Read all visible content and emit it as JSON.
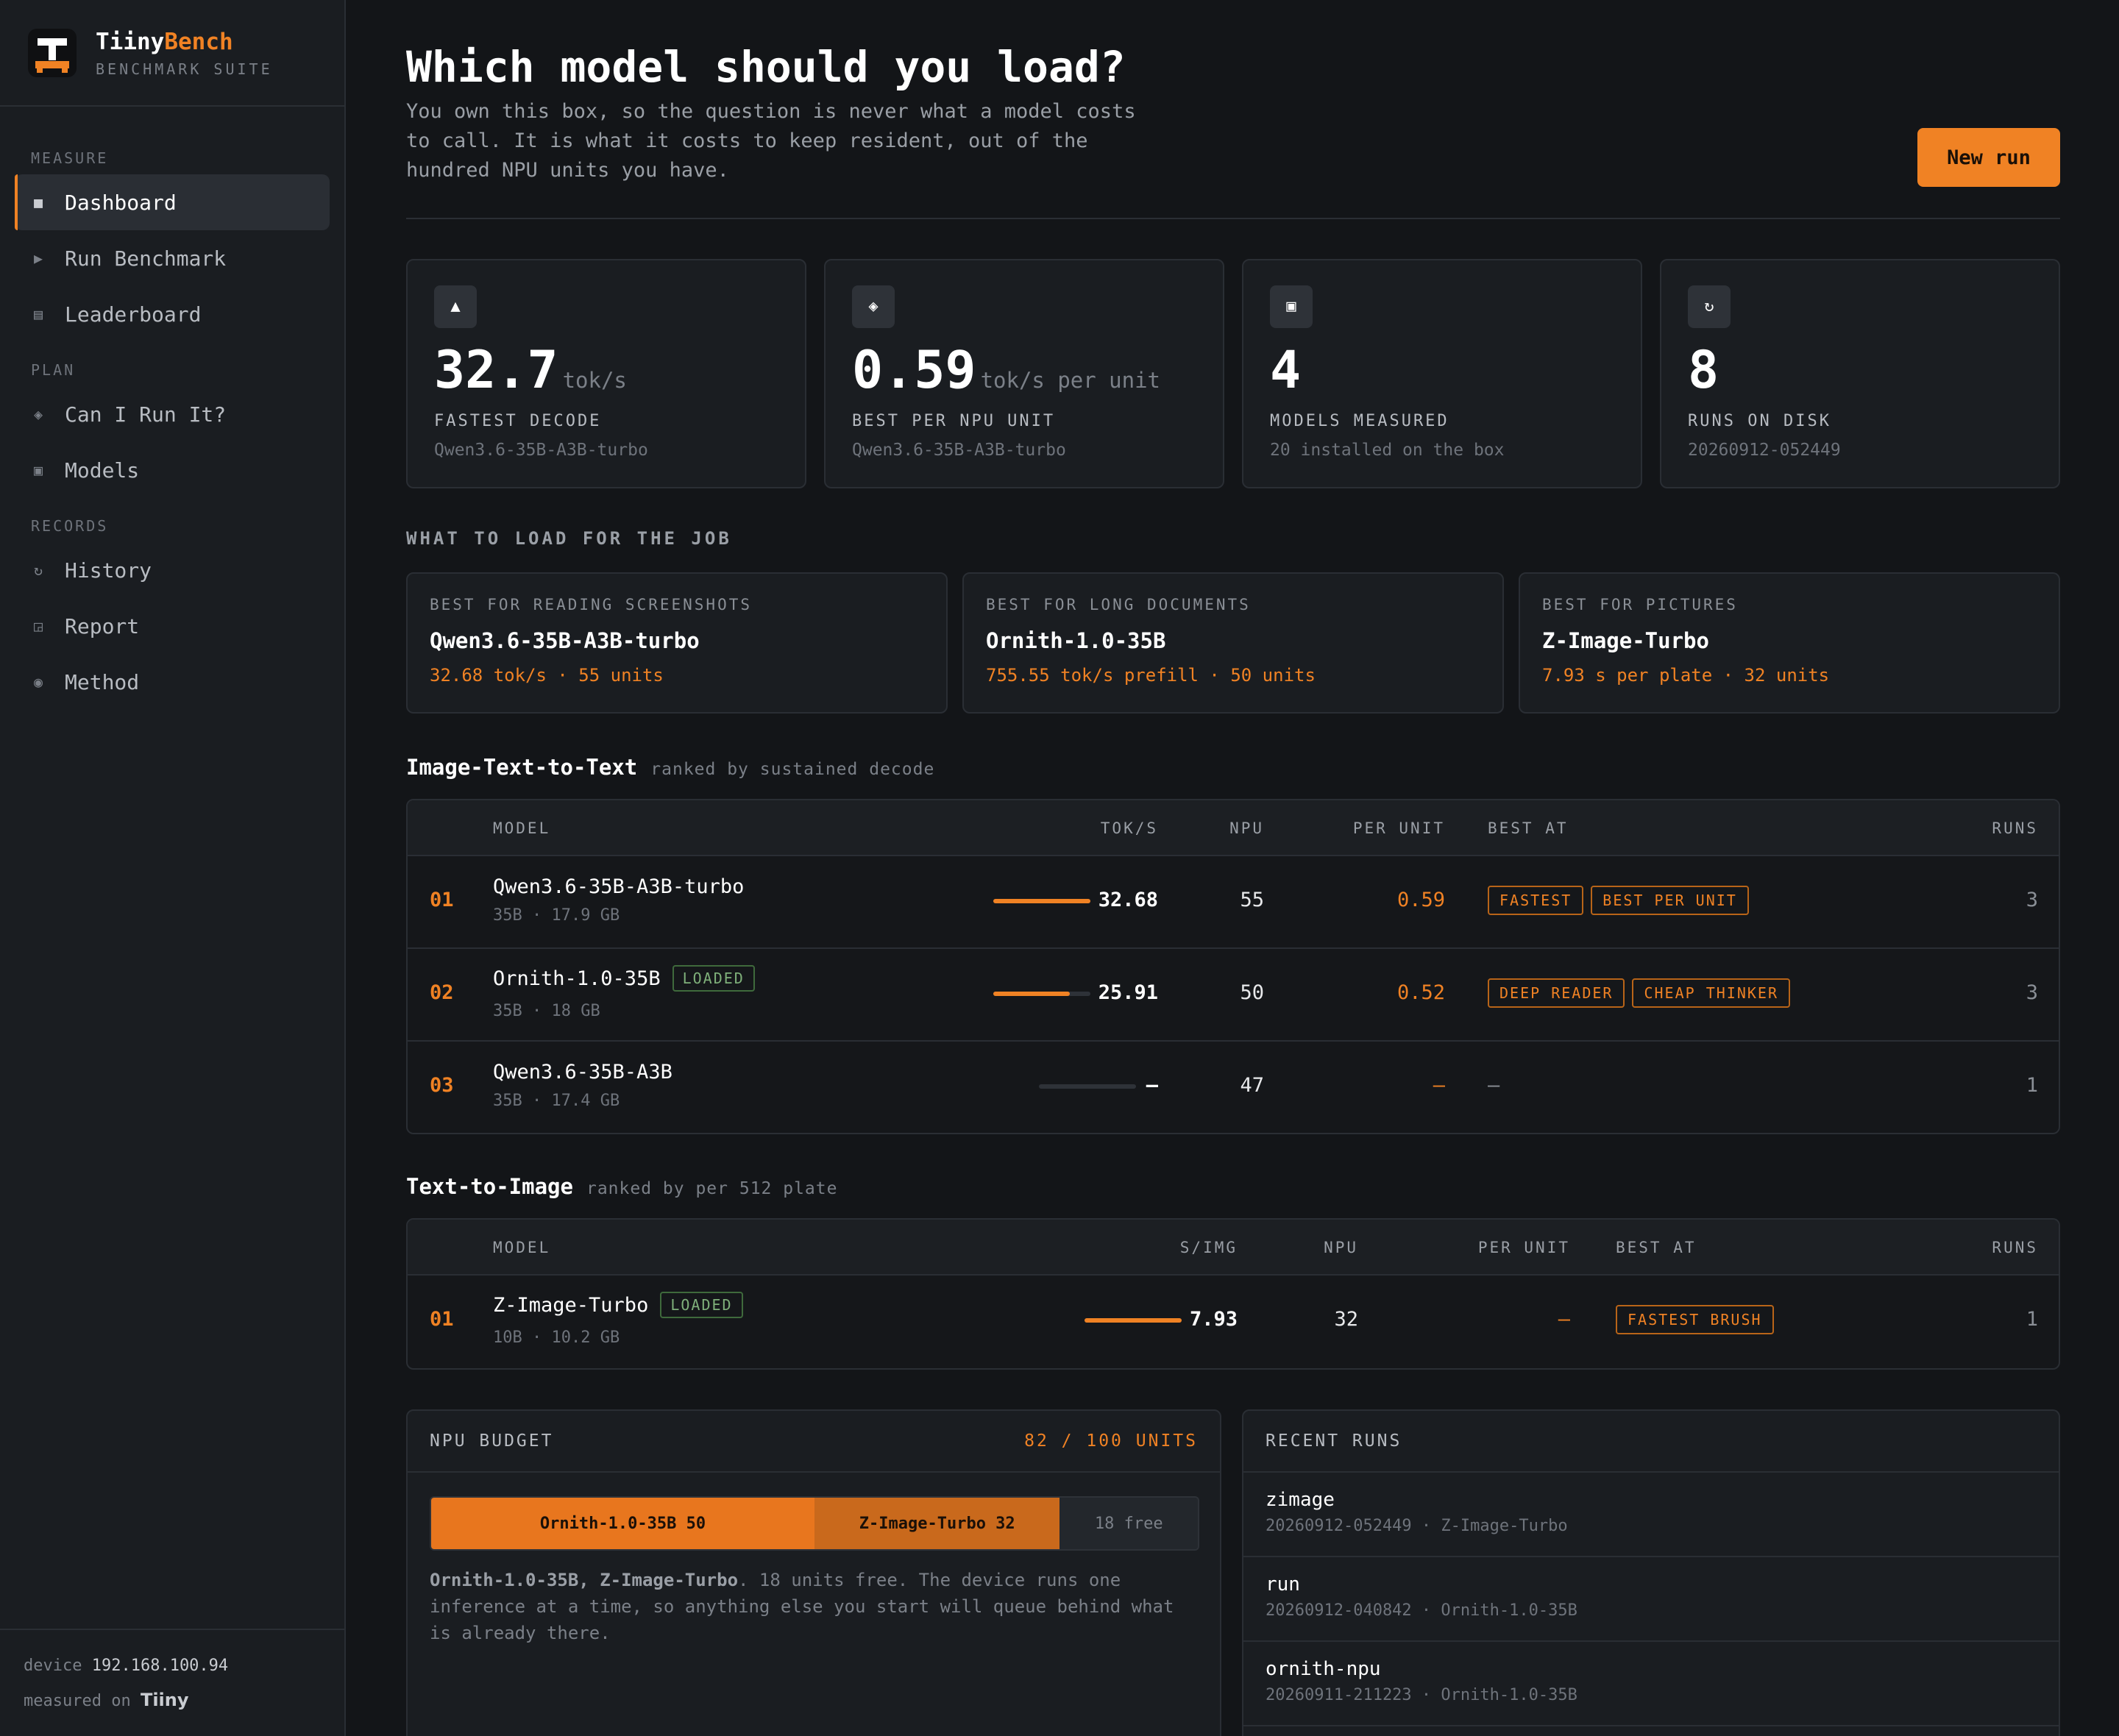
{
  "brand": {
    "name_a": "Tiiny",
    "name_b": "Bench",
    "subtitle": "BENCHMARK SUITE"
  },
  "nav": {
    "sections": [
      "MEASURE",
      "PLAN",
      "RECORDS"
    ],
    "items": [
      {
        "label": "Dashboard",
        "icon": "■",
        "active": true
      },
      {
        "label": "Run Benchmark",
        "icon": "▶"
      },
      {
        "label": "Leaderboard",
        "icon": "▤"
      },
      {
        "label": "Can I Run It?",
        "icon": "◈"
      },
      {
        "label": "Models",
        "icon": "▣"
      },
      {
        "label": "History",
        "icon": "↻"
      },
      {
        "label": "Report",
        "icon": "◲"
      },
      {
        "label": "Method",
        "icon": "◉"
      }
    ]
  },
  "footer": {
    "device_label": "device",
    "device_value": "192.168.100.94",
    "measured_label": "measured on",
    "measured_brand": "Tiiny"
  },
  "header": {
    "title": "Which model should you load?",
    "subtitle": "You own this box, so the question is never what a model costs to call. It is what it costs to keep resident, out of the hundred NPU units you have.",
    "new_run": "New run"
  },
  "stats": [
    {
      "icon": "▲",
      "value": "32.7",
      "unit": "tok/s",
      "label": "FASTEST DECODE",
      "sub": "Qwen3.6-35B-A3B-turbo"
    },
    {
      "icon": "◈",
      "value": "0.59",
      "unit": "tok/s per unit",
      "label": "BEST PER NPU UNIT",
      "sub": "Qwen3.6-35B-A3B-turbo"
    },
    {
      "icon": "▣",
      "value": "4",
      "unit": "",
      "label": "MODELS MEASURED",
      "sub": "20 installed on the box"
    },
    {
      "icon": "↻",
      "value": "8",
      "unit": "",
      "label": "RUNS ON DISK",
      "sub": "20260912-052449"
    }
  ],
  "jobs": {
    "heading": "WHAT TO LOAD FOR THE JOB",
    "cards": [
      {
        "label": "BEST FOR READING SCREENSHOTS",
        "model": "Qwen3.6-35B-A3B-turbo",
        "stat": "32.68 tok/s · 55 units"
      },
      {
        "label": "BEST FOR LONG DOCUMENTS",
        "model": "Ornith-1.0-35B",
        "stat": "755.55 tok/s prefill · 50 units"
      },
      {
        "label": "BEST FOR PICTURES",
        "model": "Z-Image-Turbo",
        "stat": "7.93 s per plate · 32 units"
      }
    ]
  },
  "itt": {
    "title": "Image-Text-to-Text",
    "hint": "ranked by sustained decode",
    "columns": {
      "model": "MODEL",
      "metric": "TOK/S",
      "npu": "NPU",
      "per_unit": "PER UNIT",
      "best_at": "BEST AT",
      "runs": "RUNS"
    },
    "rows": [
      {
        "rank": "01",
        "name": "Qwen3.6-35B-A3B-turbo",
        "loaded": "",
        "meta": "35B · 17.9 GB",
        "fill": 1.0,
        "metric": "32.68",
        "npu": "55",
        "per_unit": "0.59",
        "tags": [
          "FASTEST",
          "BEST PER UNIT"
        ],
        "runs": "3"
      },
      {
        "rank": "02",
        "name": "Ornith-1.0-35B",
        "loaded": "LOADED",
        "meta": "35B · 18 GB",
        "fill": 0.79,
        "metric": "25.91",
        "npu": "50",
        "per_unit": "0.52",
        "tags": [
          "DEEP READER",
          "CHEAP THINKER"
        ],
        "runs": "3"
      },
      {
        "rank": "03",
        "name": "Qwen3.6-35B-A3B",
        "loaded": "",
        "meta": "35B · 17.4 GB",
        "fill": 0,
        "metric": "–",
        "npu": "47",
        "per_unit": "–",
        "tags": [],
        "no_tags": "–",
        "runs": "1"
      }
    ]
  },
  "tti": {
    "title": "Text-to-Image",
    "hint": "ranked by per 512 plate",
    "columns": {
      "model": "MODEL",
      "metric": "S/IMG",
      "npu": "NPU",
      "per_unit": "PER UNIT",
      "best_at": "BEST AT",
      "runs": "RUNS"
    },
    "rows": [
      {
        "rank": "01",
        "name": "Z-Image-Turbo",
        "loaded": "LOADED",
        "meta": "10B · 10.2 GB",
        "fill": 1.0,
        "metric": "7.93",
        "npu": "32",
        "per_unit": "–",
        "tags": [
          "FASTEST BRUSH"
        ],
        "runs": "1"
      }
    ]
  },
  "budget": {
    "title": "NPU BUDGET",
    "total": "82 / 100 UNITS",
    "segments": [
      {
        "label": "Ornith-1.0-35B 50",
        "units": 50,
        "color": "#e8761e"
      },
      {
        "label": "Z-Image-Turbo 32",
        "units": 32,
        "color": "#c9691c"
      },
      {
        "label": "18 free",
        "units": 18,
        "color": "#23272c",
        "free": true
      }
    ],
    "note_strong": "Ornith-1.0-35B, Z-Image-Turbo",
    "note": ". 18 units free. The device runs one inference at a time, so anything else you start will queue behind what is already there."
  },
  "recent": {
    "title": "RECENT RUNS",
    "items": [
      {
        "name": "zimage",
        "meta": "20260912-052449 · Z-Image-Turbo"
      },
      {
        "name": "run",
        "meta": "20260912-040842 · Ornith-1.0-35B"
      },
      {
        "name": "ornith-npu",
        "meta": "20260911-211223 · Ornith-1.0-35B"
      }
    ]
  }
}
